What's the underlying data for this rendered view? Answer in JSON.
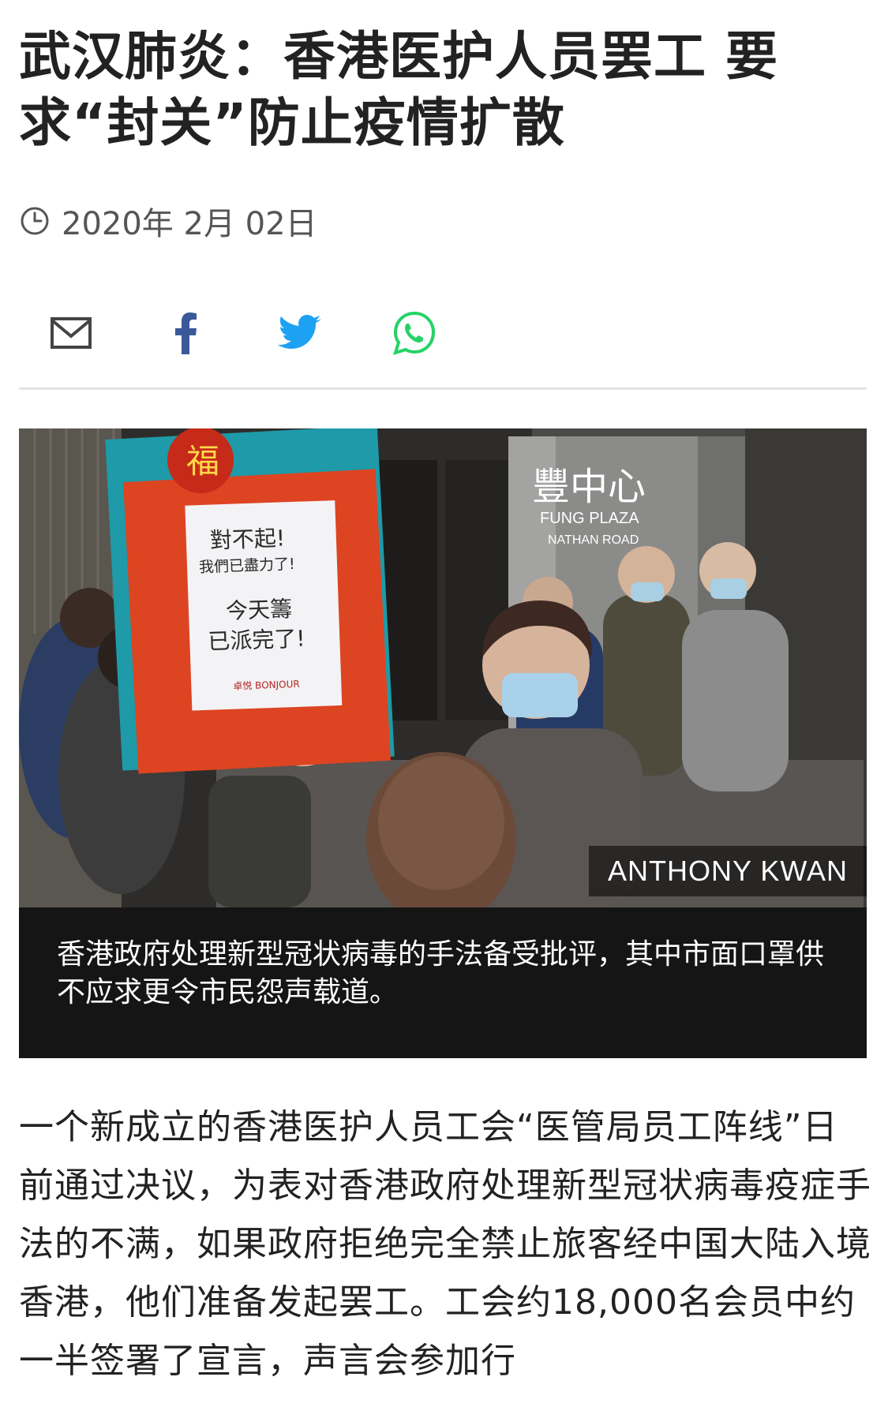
{
  "article": {
    "headline": "武汉肺炎：香港医护人员罢工 要求“封关”防止疫情扩散",
    "date": "2020年 2月 02日",
    "share": {
      "icons": [
        "email-icon",
        "facebook-icon",
        "twitter-icon",
        "whatsapp-icon"
      ]
    },
    "image": {
      "credit": "ANTHONY KWAN",
      "caption": "香港政府处理新型冠状病毒的手法备受批评，其中市面口罩供不应求更令市民怨声载道。",
      "sign_lines": [
        "對不起!",
        "我們已盡力了!",
        "今天籌",
        "已派完了!"
      ],
      "sign_brand": "卓悦 BONJOUR",
      "building_name": "豐中心",
      "building_sub1": "FUNG PLAZA",
      "building_sub2": "NATHAN ROAD"
    },
    "body": "一个新成立的香港医护人员工会“医管局员工阵线”日前通过决议，为表对香港政府处理新型冠状病毒疫症手法的不满，如果政府拒绝完全禁止旅客经中国大陆入境香港，他们准备发起罢工。工会约18,000名会员中约一半签署了宣言，声言会参加行"
  },
  "colors": {
    "text": "#222222",
    "meta": "#555555",
    "facebook": "#3b5998",
    "twitter": "#1da1f2",
    "whatsapp": "#25d366",
    "caption_bg": "#151515"
  }
}
